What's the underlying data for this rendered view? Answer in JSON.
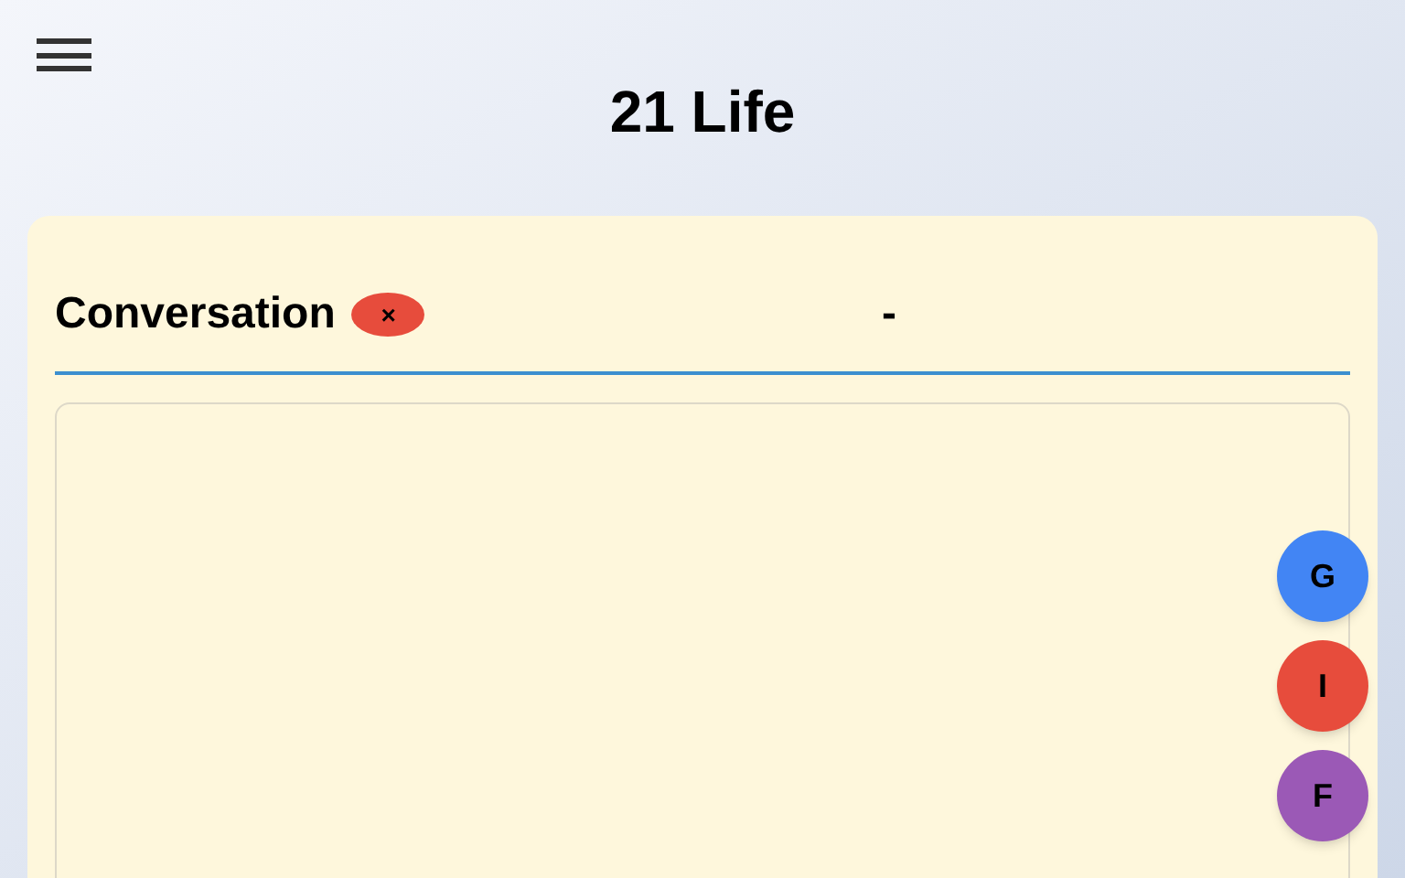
{
  "header": {
    "title": "21 Life"
  },
  "conversation": {
    "title": "Conversation",
    "close_label": "×",
    "status": "-"
  },
  "floating_buttons": [
    {
      "label": "G",
      "color": "#4285f4"
    },
    {
      "label": "I",
      "color": "#e74c3c"
    },
    {
      "label": "F",
      "color": "#9b59b6"
    }
  ]
}
